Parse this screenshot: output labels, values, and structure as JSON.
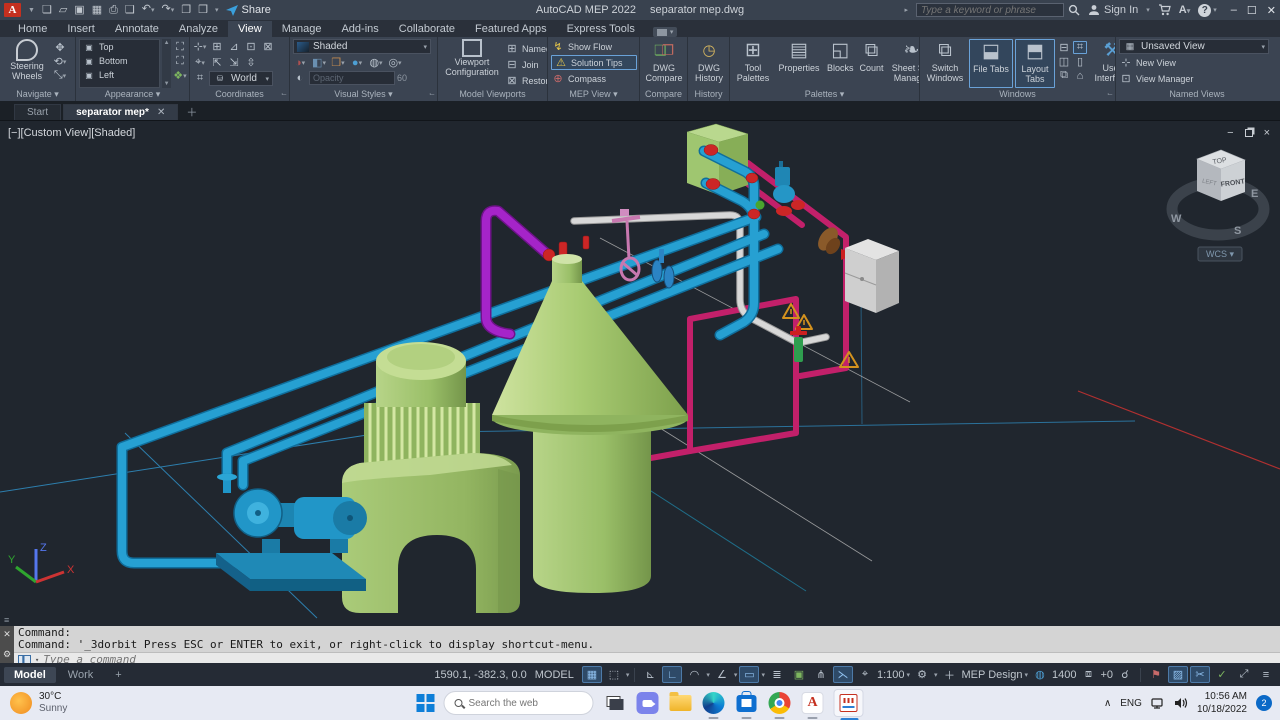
{
  "titlebar": {
    "app": "AutoCAD MEP 2022",
    "doc": "separator mep.dwg",
    "share": "Share",
    "search_placeholder": "Type a keyword or phrase",
    "sign_in": "Sign In",
    "autodesk_a": "A"
  },
  "tabs": {
    "items": [
      "Home",
      "Insert",
      "Annotate",
      "Analyze",
      "View",
      "Manage",
      "Add-ins",
      "Collaborate",
      "Featured Apps",
      "Express Tools"
    ]
  },
  "ribbon": {
    "navigate": {
      "label": "Navigate",
      "steering": "Steering Wheels"
    },
    "appearance": {
      "label": "Appearance",
      "top": "Top",
      "bottom": "Bottom",
      "left": "Left"
    },
    "coordinates": {
      "label": "Coordinates",
      "world": "World"
    },
    "visual": {
      "label": "Visual Styles",
      "style": "Shaded",
      "opacity": "Opacity",
      "opacity_value": "60"
    },
    "viewports": {
      "label": "Model Viewports",
      "config": "Viewport Configuration",
      "named": "Named",
      "join": "Join",
      "restore": "Restore"
    },
    "mep": {
      "label": "MEP View",
      "show_flow": "Show Flow",
      "solution_tips": "Solution Tips",
      "compass": "Compass"
    },
    "compare": {
      "label": "Compare",
      "main": "DWG Compare"
    },
    "history": {
      "label": "History",
      "main": "DWG History"
    },
    "palettes": {
      "label": "Palettes",
      "tool": "Tool Palettes",
      "properties": "Properties",
      "blocks": "Blocks",
      "count": "Count",
      "sheet": "Sheet Set Manager"
    },
    "windows": {
      "label": "Windows",
      "switch": "Switch Windows",
      "file_tabs": "File Tabs",
      "layout_tabs": "Layout Tabs",
      "ui": "User Interface"
    },
    "views": {
      "label": "Named Views",
      "current": "Unsaved View",
      "new": "New View",
      "manager": "View Manager"
    }
  },
  "file_tabs": {
    "start": "Start",
    "doc": "separator mep*"
  },
  "viewport": {
    "label": "[−][Custom View][Shaded]",
    "wcs": "WCS ▾",
    "cube": {
      "top": "TOP",
      "front": "FRONT",
      "left": "LEFT"
    },
    "compass": {
      "w": "W",
      "s": "S",
      "e": "E"
    },
    "ucs": {
      "x": "X",
      "y": "Y",
      "z": "Z"
    }
  },
  "command": {
    "line1": "Command:",
    "line2": "Command: '_3dorbit Press ESC or ENTER to exit, or right-click to display shortcut-menu.",
    "placeholder": "Type a command"
  },
  "layout": {
    "model": "Model",
    "work": "Work"
  },
  "status": {
    "coords": "1590.1, -382.3, 0.0",
    "model": "MODEL",
    "scale": "1:100",
    "workspace": "MEP Design",
    "annot_value": "1400",
    "annot_plus": "+0"
  },
  "taskbar": {
    "temp": "30°C",
    "condition": "Sunny",
    "search_placeholder": "Search the web",
    "lang": "ENG",
    "time": "10:56 AM",
    "date": "10/18/2022",
    "badge": "2"
  },
  "colors": {
    "accent": "#4d82b8",
    "acad_red": "#c5301f",
    "pipe_cyan": "#1f97c9",
    "pipe_magenta": "#9b1fbf",
    "pipe_crimson": "#c2206a",
    "machine_green": "#a8cb72"
  }
}
